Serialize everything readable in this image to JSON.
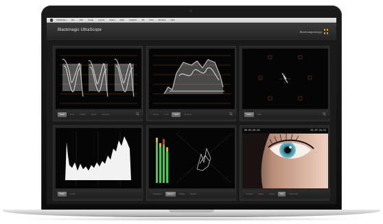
{
  "app": {
    "title": "Blackmagic UltraScope",
    "brand": "Blackmagicdesign"
  },
  "menubar": {
    "items": [
      "UltraScope",
      "File",
      "Edit",
      "Image",
      "Layout",
      "Select",
      "Filter",
      "Analysis",
      "3D",
      "View",
      "Window",
      "Help"
    ]
  },
  "panels": [
    {
      "scope": "parade",
      "tabs": [
        "RGB",
        "YUV",
        "YCbCr",
        "Luma",
        "Chroma"
      ],
      "active_tab": 0
    },
    {
      "scope": "waveform",
      "tabs": [
        "Luma",
        "Y Lut",
        "RGB",
        "Chroma"
      ],
      "active_tab": 2
    },
    {
      "scope": "vectorscope",
      "tabs": [
        "100%",
        "75%"
      ],
      "active_tab": 0
    },
    {
      "scope": "histogram",
      "tabs": [
        "RGB",
        "Luma"
      ],
      "active_tab": 0
    },
    {
      "scope": "audio",
      "tabs": [
        "Lissajous",
        "Meters",
        "Phase",
        "Stereo"
      ],
      "active_tab": 1
    },
    {
      "scope": "picture",
      "tabs": [
        "Picture",
        "Alarm",
        "Zebra",
        "Info",
        "Safe Area"
      ],
      "active_tab": 3,
      "timecode_left": "00:01:29:16",
      "timecode_right": "01:07:34:12"
    }
  ],
  "colors": {
    "brand_orange": "#e08a2b",
    "scope_trace": "#e8e8e8",
    "graticule": "#7a3a14",
    "meter_green": "#3ccf4a",
    "meter_amber": "#d8b23a",
    "meter_red": "#cc3a2a"
  },
  "icons": {
    "tab_settings": "magnifier-icon",
    "brand": "brand-logo-icon",
    "camera": "camera-dot-icon"
  }
}
